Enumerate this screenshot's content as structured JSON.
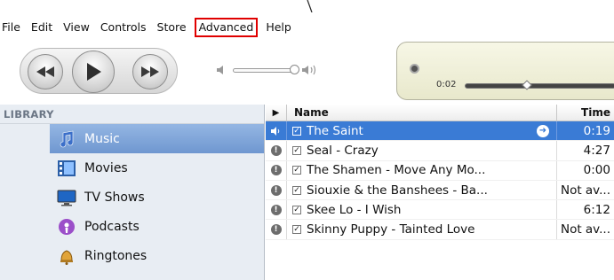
{
  "menu": [
    "File",
    "Edit",
    "View",
    "Controls",
    "Store",
    "Advanced",
    "Help"
  ],
  "highlighted_menu": "Advanced",
  "player": {
    "elapsed": "0:02"
  },
  "sidebar": {
    "header": "LIBRARY",
    "items": [
      {
        "label": "Music",
        "icon": "music-note-icon"
      },
      {
        "label": "Movies",
        "icon": "film-icon"
      },
      {
        "label": "TV Shows",
        "icon": "tv-icon"
      },
      {
        "label": "Podcasts",
        "icon": "podcast-icon"
      },
      {
        "label": "Ringtones",
        "icon": "bell-icon"
      }
    ]
  },
  "list": {
    "headers": {
      "status": "▶",
      "name": "Name",
      "time": "Time"
    },
    "rows": [
      {
        "name": "The Saint",
        "time": "0:19"
      },
      {
        "name": "Seal - Crazy",
        "time": "4:27"
      },
      {
        "name": "The Shamen - Move Any Mo...",
        "time": "0:00"
      },
      {
        "name": "Siouxie & the Banshees - Ba...",
        "time": "Not av..."
      },
      {
        "name": "Skee Lo - I Wish",
        "time": "6:12"
      },
      {
        "name": "Skinny Puppy - Tainted Love",
        "time": "Not av..."
      }
    ]
  },
  "colors": {
    "selection": "#3a7bd5",
    "highlight_border": "#e00000",
    "sidebar_bg": "#e8edf3"
  }
}
